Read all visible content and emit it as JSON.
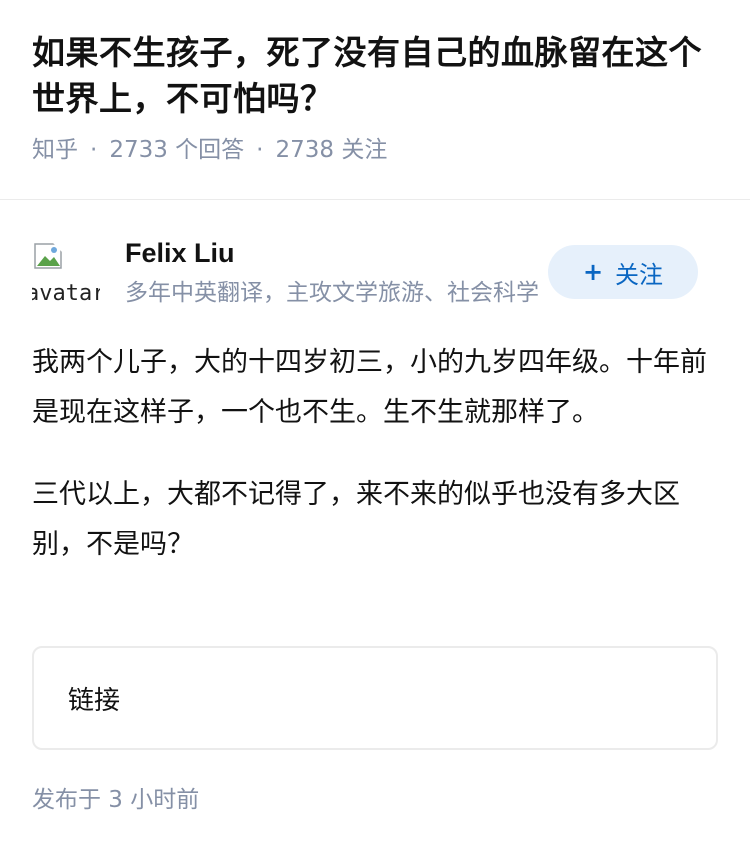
{
  "question": {
    "title": "如果不生孩子，死了没有自己的血脉留在这个世界上，不可怕吗？",
    "site": "知乎",
    "answers_count": "2733 个回答",
    "followers_count": "2738 关注"
  },
  "author": {
    "avatar_alt": "avatar",
    "name": "Felix Liu",
    "bio": "多年中英翻译，主攻文学旅游、社会科学",
    "follow_label": "关注",
    "follow_icon": "+"
  },
  "answer": {
    "paragraphs": [
      "我两个儿子，大的十四岁初三，小的九岁四年级。十年前是现在这样子，一个也不生。生不生就那样了。",
      "三代以上，大都不记得了，来不来的似乎也没有多大区别，不是吗？"
    ],
    "link_label": "链接",
    "published": "发布于 3 小时前"
  },
  "colors": {
    "meta_gray": "#8590a6",
    "follow_bg": "#e6f0fb",
    "follow_text": "#0a66c2",
    "text": "#121212"
  }
}
